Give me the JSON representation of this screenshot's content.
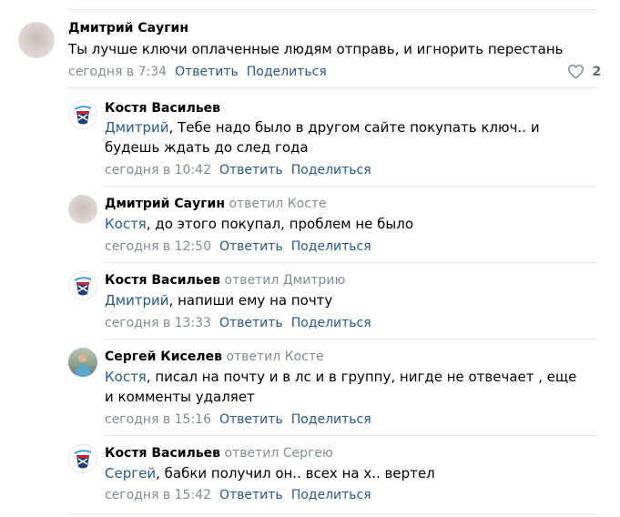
{
  "comments": [
    {
      "author": "Дмитрий Саугин",
      "reply_to": "",
      "mention": "",
      "text": "Ты лучше ключи оплаченные людям отправь, и игнорить перестань",
      "time": "сегодня в 7:34",
      "reply_label": "Ответить",
      "share_label": "Поделиться",
      "likes": "2"
    },
    {
      "author": "Костя Васильев",
      "reply_to": "",
      "mention": "Дмитрий",
      "text": ", Тебе надо было в другом сайте покупать ключ.. и будешь ждать до след года",
      "time": "сегодня в 10:42",
      "reply_label": "Ответить",
      "share_label": "Поделиться"
    },
    {
      "author": "Дмитрий Саугин",
      "reply_to": "ответил Косте",
      "mention": "Костя",
      "text": ", до этого покупал, проблем не было",
      "time": "сегодня в 12:50",
      "reply_label": "Ответить",
      "share_label": "Поделиться"
    },
    {
      "author": "Костя Васильев",
      "reply_to": "ответил Дмитрию",
      "mention": "Дмитрий",
      "text": ", напиши ему на почту",
      "time": "сегодня в 13:33",
      "reply_label": "Ответить",
      "share_label": "Поделиться"
    },
    {
      "author": "Сергей Киселев",
      "reply_to": "ответил Косте",
      "mention": "Костя",
      "text": ", писал на почту и в лс и в группу, нигде не отвечает , еще и комменты удаляет",
      "time": "сегодня в 15:16",
      "reply_label": "Ответить",
      "share_label": "Поделиться"
    },
    {
      "author": "Костя Васильев",
      "reply_to": "ответил Сергею",
      "mention": "Сергей",
      "text": ", бабки получил он.. всех на х.. вертел",
      "time": "сегодня в 15:42",
      "reply_label": "Ответить",
      "share_label": "Поделиться"
    }
  ]
}
